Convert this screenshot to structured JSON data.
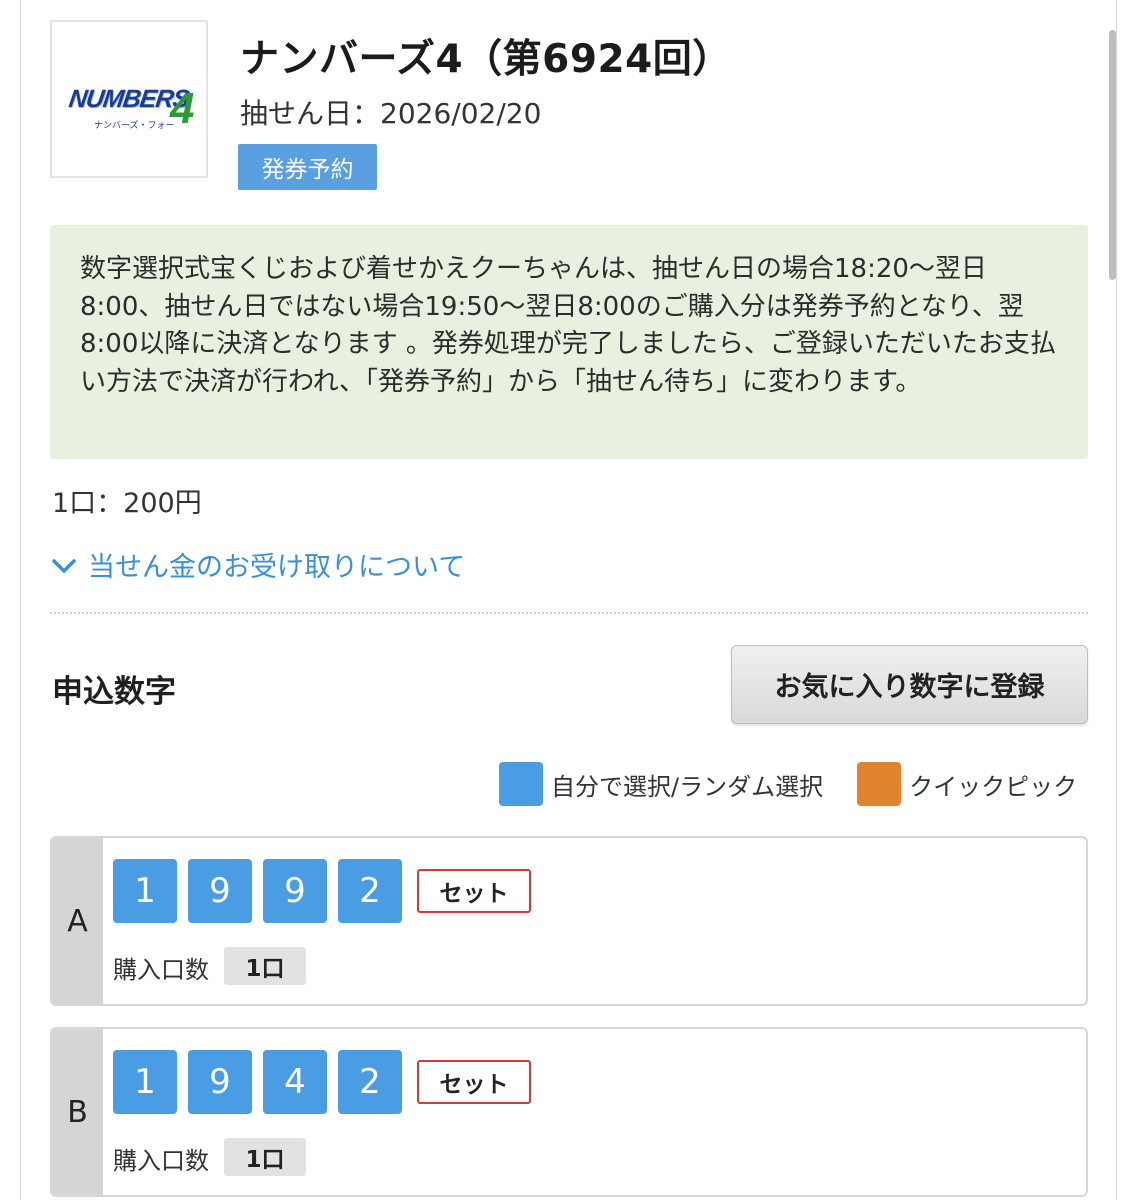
{
  "header": {
    "logo_text": "NUMBERS",
    "logo_digit": "4",
    "logo_sub": "ナンバーズ・フォー",
    "title": "ナンバーズ4（第6924回）",
    "draw_date": "抽せん日：2026/02/20",
    "status_badge": "発券予約"
  },
  "notice": {
    "text": "数字選択式宝くじおよび着せかえクーちゃんは、抽せん日の場合18:20〜翌日8:00、抽せん日ではない場合19:50〜翌日8:00のご購入分は発券予約となり、翌8:00以降に決済となります 。発券処理が完了しましたら、ご登録いただいたお支払い方法で決済が行われ、「発券予約」から「抽せん待ち」に変わります。"
  },
  "price": "1口：200円",
  "prize_link": "当せん金のお受け取りについて",
  "section": {
    "title": "申込数字",
    "favorite_button": "お気に入り数字に登録"
  },
  "legend": {
    "manual": {
      "label": "自分で選択/ランダム選択",
      "color": "#4a9de2"
    },
    "quick": {
      "label": "クイックピック",
      "color": "#e2832e"
    }
  },
  "entries": [
    {
      "letter": "A",
      "digits": [
        "1",
        "9",
        "9",
        "2"
      ],
      "type_badge": "セット",
      "qty_label": "購入口数",
      "qty_value": "1口"
    },
    {
      "letter": "B",
      "digits": [
        "1",
        "9",
        "4",
        "2"
      ],
      "type_badge": "セット",
      "qty_label": "購入口数",
      "qty_value": "1口"
    }
  ]
}
